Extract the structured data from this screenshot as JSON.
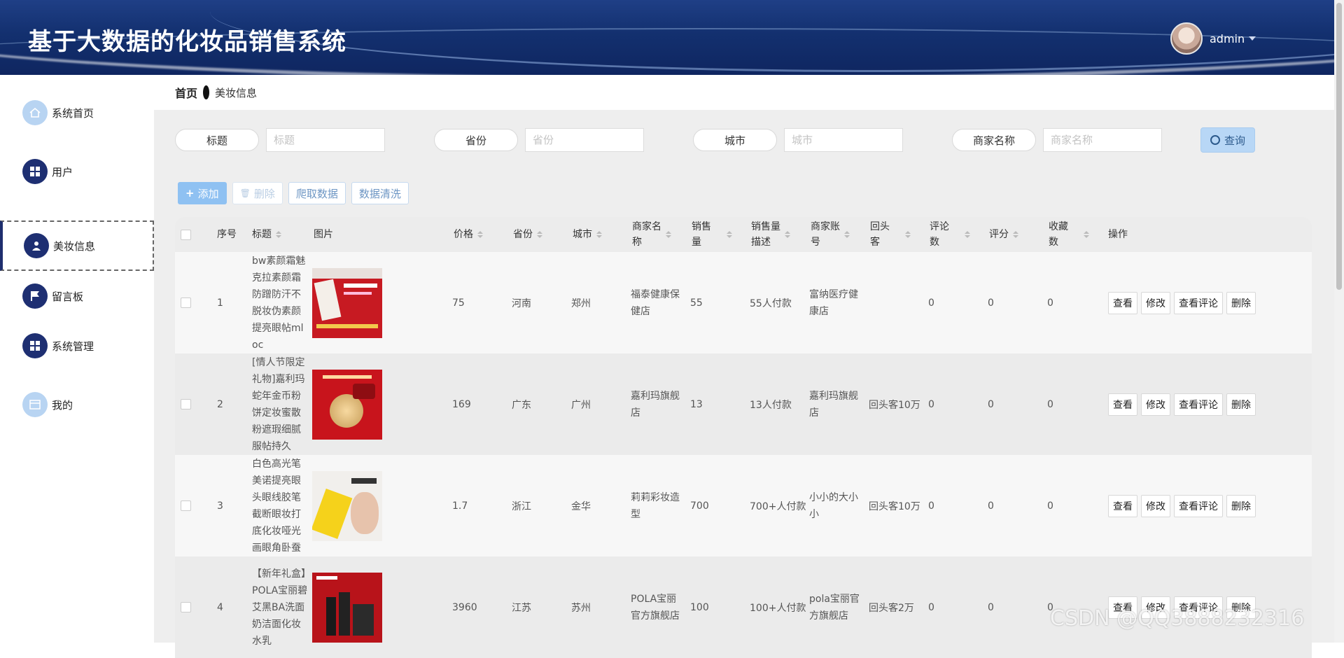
{
  "app": {
    "title": "基于大数据的化妆品销售系统",
    "user": "admin"
  },
  "sidebar": {
    "items": [
      {
        "label": "系统首页",
        "icon": "home-icon"
      },
      {
        "label": "用户",
        "icon": "grid-icon"
      },
      {
        "label": "美妆信息",
        "icon": "user-icon",
        "active": true
      },
      {
        "label": "留言板",
        "icon": "flag-icon"
      },
      {
        "label": "系统管理",
        "icon": "grid-icon"
      },
      {
        "label": "我的",
        "icon": "calendar-icon"
      }
    ]
  },
  "breadcrumb": {
    "home": "首页",
    "current": "美妆信息"
  },
  "search": {
    "fields": [
      {
        "label": "标题",
        "placeholder": "标题"
      },
      {
        "label": "省份",
        "placeholder": "省份"
      },
      {
        "label": "城市",
        "placeholder": "城市"
      },
      {
        "label": "商家名称",
        "placeholder": "商家名称"
      }
    ],
    "query_label": "查询"
  },
  "actions": {
    "add": "添加",
    "delete": "删除",
    "crawl": "爬取数据",
    "clean": "数据清洗"
  },
  "table": {
    "headers": {
      "index": "序号",
      "title": "标题",
      "image": "图片",
      "price": "价格",
      "province": "省份",
      "city": "城市",
      "merchant": "商家名\n称",
      "sales": "销售\n量",
      "sales_desc": "销售量\n描述",
      "account": "商家账\n号",
      "repeat": "回头\n客",
      "comments": "评论\n数",
      "rating": "评分",
      "favorites": "收藏\n数",
      "ops": "操作"
    },
    "rows": [
      {
        "index": "1",
        "title": "bw素颜霜魅克拉素颜霜防蹭防汗不脱妆伪素颜提亮眼帖mloc",
        "price": "75",
        "province": "河南",
        "city": "郑州",
        "merchant": "福泰健康保健店",
        "sales": "55",
        "sales_desc": "55人付款",
        "account": "富纳医疗健康店",
        "repeat": "",
        "comments": "0",
        "rating": "0",
        "favorites": "0"
      },
      {
        "index": "2",
        "title": "[情人节限定礼物]嘉利玛蛇年金币粉饼定妆蜜散粉遮瑕细腻服帖持久",
        "price": "169",
        "province": "广东",
        "city": "广州",
        "merchant": "嘉利玛旗舰店",
        "sales": "13",
        "sales_desc": "13人付款",
        "account": "嘉利玛旗舰店",
        "repeat": "回头客10万",
        "comments": "0",
        "rating": "0",
        "favorites": "0"
      },
      {
        "index": "3",
        "title": "白色高光笔美诺提亮眼头眼线胶笔截断眼妆打底化妆哑光画眼角卧蚕",
        "price": "1.7",
        "province": "浙江",
        "city": "金华",
        "merchant": "莉莉彩妆造型",
        "sales": "700",
        "sales_desc": "700+人付款",
        "account": "小小的大小小",
        "repeat": "回头客10万",
        "comments": "0",
        "rating": "0",
        "favorites": "0"
      },
      {
        "index": "4",
        "title": "【新年礼盒】POLA宝丽碧艾黑BA洗面奶洁面化妆水乳",
        "price": "3960",
        "province": "江苏",
        "city": "苏州",
        "merchant": "POLA宝丽官方旗舰店",
        "sales": "100",
        "sales_desc": "100+人付款",
        "account": "pola宝丽官方旗舰店",
        "repeat": "回头客2万",
        "comments": "0",
        "rating": "0",
        "favorites": "0"
      }
    ],
    "row_ops": [
      "查看",
      "修改",
      "查看评论",
      "删除"
    ]
  },
  "watermark": "CSDN @QQ3888232316",
  "colors": {
    "header": "#13306f",
    "nav_dark": "#1e2f72",
    "nav_light": "#b8d4f2",
    "primary": "#8fc1f2"
  }
}
